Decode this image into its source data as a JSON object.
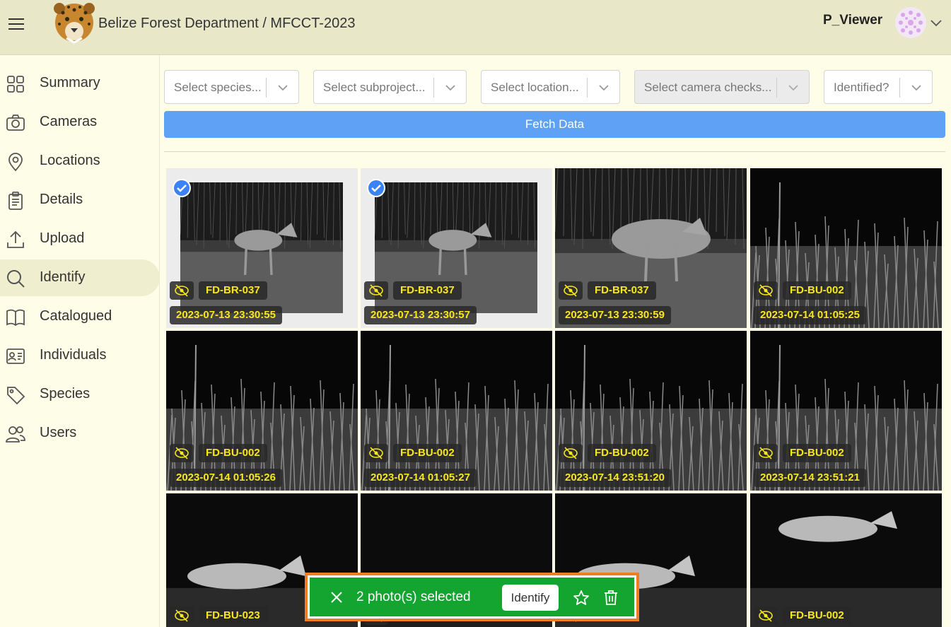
{
  "header": {
    "title": "Belize Forest Department / MFCCT-2023",
    "username": "P_Viewer"
  },
  "sidebar": {
    "items": [
      {
        "label": "Summary",
        "icon": "grid-icon"
      },
      {
        "label": "Cameras",
        "icon": "camera-icon"
      },
      {
        "label": "Locations",
        "icon": "map-pin-icon"
      },
      {
        "label": "Details",
        "icon": "clipboard-icon"
      },
      {
        "label": "Upload",
        "icon": "upload-icon"
      },
      {
        "label": "Identify",
        "icon": "search-icon",
        "active": true
      },
      {
        "label": "Catalogued",
        "icon": "book-icon"
      },
      {
        "label": "Individuals",
        "icon": "id-card-icon"
      },
      {
        "label": "Species",
        "icon": "tag-icon"
      },
      {
        "label": "Users",
        "icon": "users-icon"
      }
    ]
  },
  "filters": {
    "species_placeholder": "Select species...",
    "subproject_placeholder": "Select subproject...",
    "location_placeholder": "Select location...",
    "camera_checks_placeholder": "Select camera checks...",
    "identified_placeholder": "Identified?",
    "fetch_label": "Fetch Data"
  },
  "photos": [
    {
      "camera": "FD-BR-037",
      "datetime": "2023-07-13 23:30:55",
      "selected": true
    },
    {
      "camera": "FD-BR-037",
      "datetime": "2023-07-13 23:30:57",
      "selected": true
    },
    {
      "camera": "FD-BR-037",
      "datetime": "2023-07-13 23:30:59",
      "selected": false
    },
    {
      "camera": "FD-BU-002",
      "datetime": "2023-07-14 01:05:25",
      "selected": false
    },
    {
      "camera": "FD-BU-002",
      "datetime": "2023-07-14 01:05:26",
      "selected": false
    },
    {
      "camera": "FD-BU-002",
      "datetime": "2023-07-14 01:05:27",
      "selected": false
    },
    {
      "camera": "FD-BU-002",
      "datetime": "2023-07-14 23:51:20",
      "selected": false
    },
    {
      "camera": "FD-BU-002",
      "datetime": "2023-07-14 23:51:21",
      "selected": false
    },
    {
      "camera": "FD-BU-023",
      "datetime": "",
      "selected": false
    },
    {
      "camera": "",
      "datetime": "",
      "selected": false
    },
    {
      "camera": "",
      "datetime": "",
      "selected": false
    },
    {
      "camera": "FD-BU-002",
      "datetime": "",
      "selected": false
    }
  ],
  "selection_bar": {
    "count_text": "2 photo(s) selected",
    "identify_label": "Identify"
  },
  "colors": {
    "accent_blue": "#5ea1f5",
    "header_bg": "#e8e8c9",
    "badge_text": "#f8e71c",
    "selection_green": "#14a430",
    "highlight_orange": "#f07d1f"
  }
}
